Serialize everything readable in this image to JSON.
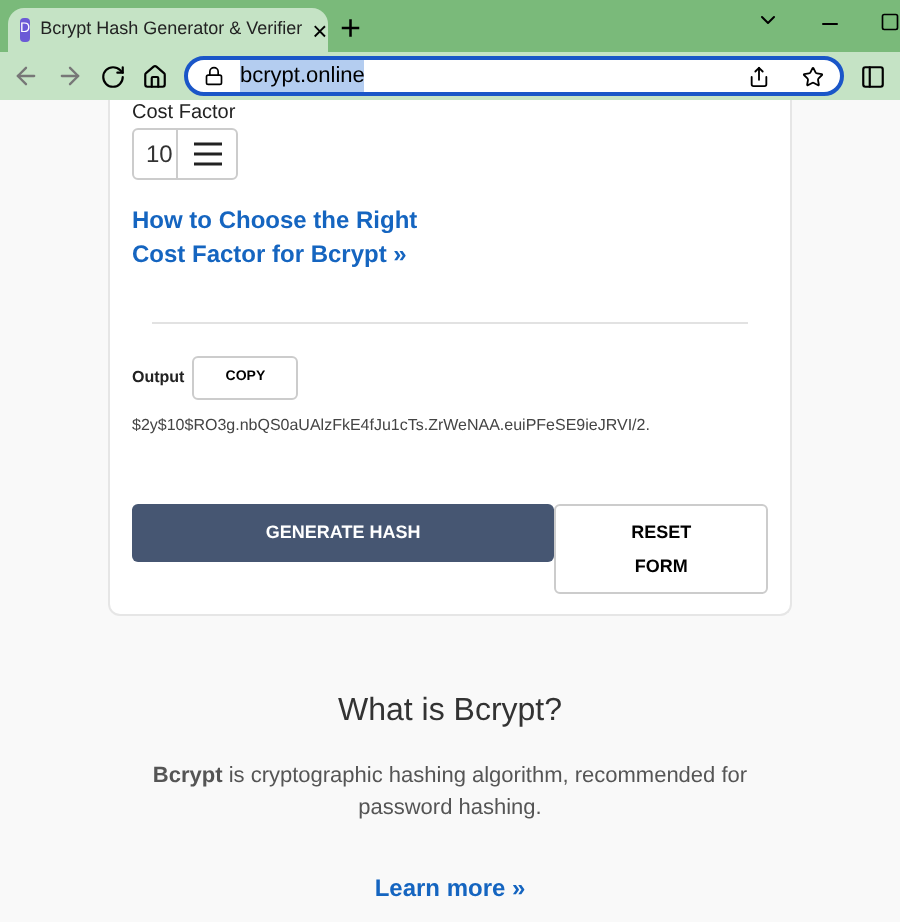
{
  "browser": {
    "tab": {
      "favicon": "D",
      "title": "Bcrypt Hash Generator & Verifier",
      "close": "×",
      "selected": true
    },
    "new_tab": "+",
    "address": "bcrypt.online"
  },
  "form": {
    "cost_factor": {
      "label": "Cost Factor",
      "value": "10"
    },
    "link": "How to Choose the Right Cost Factor for Bcrypt »",
    "output": {
      "label": "Output",
      "copy": "COPY",
      "value": "$2y$10$RO3g.nbQS0aUAlzFkE4fJu1cTs.ZrWeNAA.euiPFeSE9ieJRVI/2."
    },
    "buttons": [
      {
        "label": "GENERATE HASH",
        "kind": "primary"
      },
      {
        "label": "RESET FORM",
        "kind": "secondary"
      }
    ]
  },
  "about": {
    "title": "What is Bcrypt?",
    "text": "**Bcrypt** is cryptographic hashing algorithm, recommended for password hashing.",
    "link": "Learn more »"
  }
}
